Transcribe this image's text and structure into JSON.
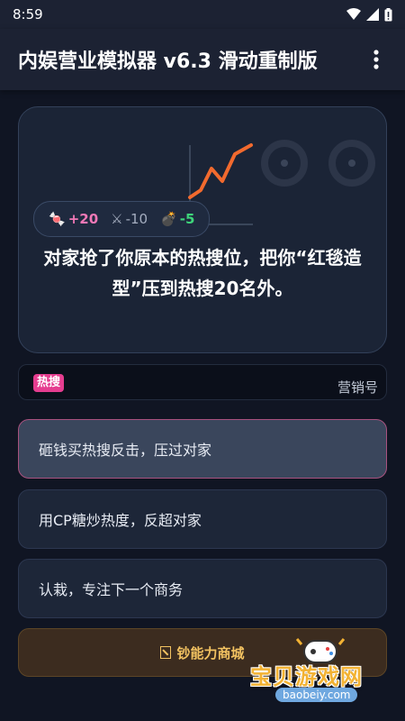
{
  "status_bar": {
    "time": "8:59"
  },
  "app_bar": {
    "title": "内娱营业模拟器 v6.3 滑动重制版",
    "menu_icon": "more-vert-icon"
  },
  "event": {
    "stats": {
      "candy": "+20",
      "sword": "-10",
      "bomb": "-5"
    },
    "text": "对家抢了你原本的热搜位，把你“红毯造型”压到热搜20名外。"
  },
  "ticker": {
    "badge": "热搜",
    "text": "营销号"
  },
  "options": [
    {
      "label": "砸钱买热搜反击，压过对家",
      "selected": true
    },
    {
      "label": "用CP糖炒热度，反超对家",
      "selected": false
    },
    {
      "label": "认栽，专注下一个商务",
      "selected": false
    }
  ],
  "shop": {
    "label": "钞能力商城"
  },
  "watermark": {
    "title": "宝贝游戏网",
    "url": "baobeiy.com"
  },
  "colors": {
    "candy": "#f178b6",
    "bomb": "#3ed57a",
    "selected_border": "#a8527f",
    "shop_text": "#f2c261"
  }
}
